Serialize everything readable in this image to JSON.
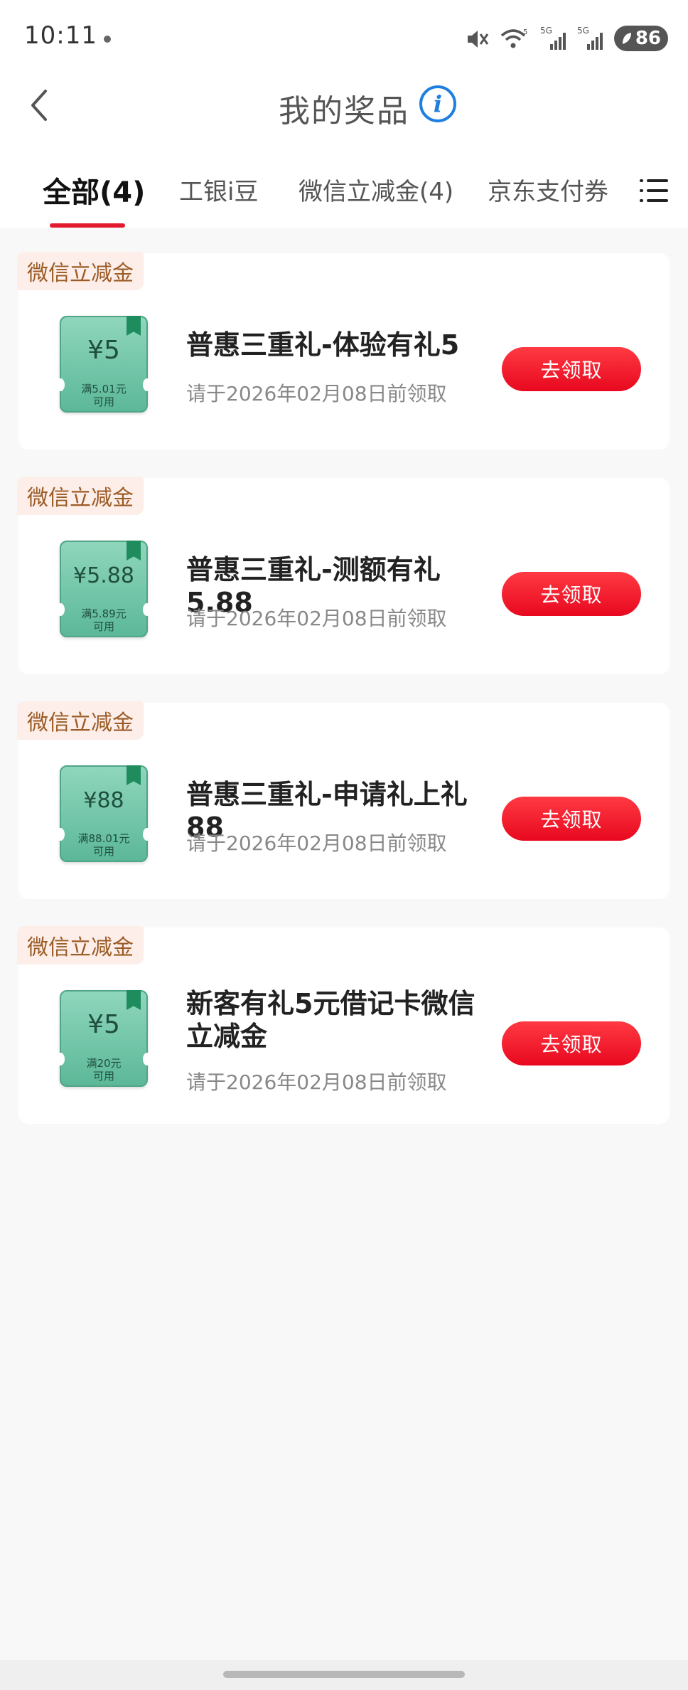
{
  "status_bar": {
    "time": "10:11",
    "battery": "86",
    "signal_1": "5G",
    "signal_2": "5G",
    "wifi_sub": "5"
  },
  "nav": {
    "title": "我的奖品"
  },
  "tabs": [
    {
      "label": "全部(4)",
      "active": true
    },
    {
      "label": "工银i豆",
      "active": false
    },
    {
      "label": "微信立减金(4)",
      "active": false
    },
    {
      "label": "京东支付券",
      "active": false
    }
  ],
  "cards": [
    {
      "tag": "微信立减金",
      "voucher_amount": "¥5",
      "voucher_condition_1": "满5.01元",
      "voucher_condition_2": "可用",
      "title": "普惠三重礼-体验有礼5",
      "date": "请于2026年02月08日前领取",
      "button": "去领取"
    },
    {
      "tag": "微信立减金",
      "voucher_amount": "¥5.88",
      "voucher_condition_1": "满5.89元",
      "voucher_condition_2": "可用",
      "title": "普惠三重礼-测额有礼5.88",
      "date": "请于2026年02月08日前领取",
      "button": "去领取"
    },
    {
      "tag": "微信立减金",
      "voucher_amount": "¥88",
      "voucher_condition_1": "满88.01元",
      "voucher_condition_2": "可用",
      "title": "普惠三重礼-申请礼上礼88",
      "date": "请于2026年02月08日前领取",
      "button": "去领取"
    },
    {
      "tag": "微信立减金",
      "voucher_amount": "¥5",
      "voucher_condition_1": "满20元",
      "voucher_condition_2": "可用",
      "title": "新客有礼5元借记卡微信立减金",
      "date": "请于2026年02月08日前领取",
      "button": "去领取"
    }
  ],
  "colors": {
    "accent_red": "#e21b2f",
    "voucher_green": "#5cb898",
    "tag_bg": "#fdeee9",
    "info_blue": "#1e7fe0"
  }
}
